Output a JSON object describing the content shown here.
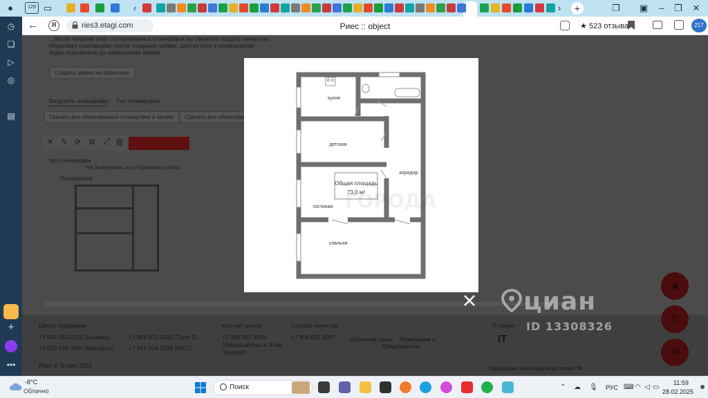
{
  "browser": {
    "tab_count_badge": "129",
    "url": "ries3.etagi.com",
    "page_title": "Риес :: object",
    "reviews": "★ 523 отзыва",
    "downloads_badge": "217"
  },
  "page": {
    "intro_lines": [
      "...после загрузки всех согласованных планировок вы сможете создать заявку на",
      "обрисовку планировки, после создания заявки, доступ есть к планировкам",
      "будет ограничена до завершения заявки."
    ],
    "create_request_btn": "Создать заявку на обрисовку",
    "upload_tab": "Загрузить планировку",
    "type_tab": "Тип планировки",
    "download_all_btn": "Скачать все обрисованные планировки в архиве",
    "delete_all_btn": "Сделать все обрисованные",
    "plan_type_label": "тип планировки",
    "no_upload_note": "Не выгружать на сторонние сайты",
    "plan_label": "Планировка"
  },
  "footer": {
    "support_title": "Центр поддержки",
    "phones_col1": [
      "+7 963 453-2222 (Билайн)",
      "+7 923 479-3097 (Мегафон)"
    ],
    "phones_col2": [
      "+7 906 871-4532 (Теле 2)",
      "+7 912 924-5289 (МТС)"
    ],
    "contact_title": "Контакт-центр",
    "contact_lines": [
      "+7 963 201 3309",
      "(Обращайтесь в Этаж",
      "Эксперт)"
    ],
    "quality_title": "Служба качества",
    "quality_phone": "+7 906 822 4297",
    "links": [
      "Обратная связь",
      "Пожелания и",
      "Предложения"
    ],
    "it_title": "IT канал",
    "it_logo": "IT",
    "copyright": "Риес © Этажи 2025",
    "footnote": "Защищено законодательством РФ"
  },
  "watermark": {
    "brand": "циан",
    "id": "ID 13308326",
    "bg_word": "ГОРОДА"
  },
  "floorplan": {
    "rooms": [
      "кухня",
      "детская",
      "коридор",
      "гостиная",
      "спальня"
    ],
    "area_label": "Общая площадь",
    "area_value": "73,0 м²"
  },
  "taskbar": {
    "weather_temp": "-8°C",
    "weather_desc": "Облачно",
    "search_placeholder": "Поиск",
    "language": "РУС",
    "time": "11:59",
    "date": "28.02.2025"
  },
  "colors": {
    "tabstrip": "#bfe2f3",
    "sidebar": "#1f3a52",
    "overlay_bg": "#4b4b4b",
    "accent_red": "#c62828",
    "wall": "#6f6f6f"
  }
}
